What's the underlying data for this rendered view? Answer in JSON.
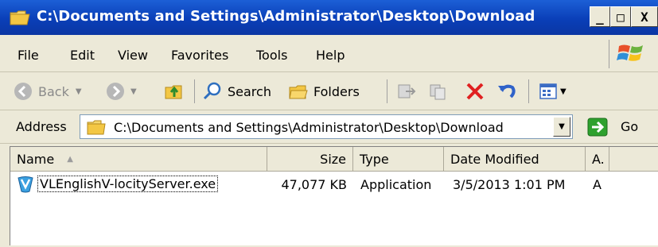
{
  "window": {
    "title": "C:\\Documents and Settings\\Administrator\\Desktop\\Download",
    "minimize_label": "_",
    "maximize_label": "□",
    "close_label": "X"
  },
  "menubar": {
    "items": [
      {
        "label": "File"
      },
      {
        "label": "Edit"
      },
      {
        "label": "View"
      },
      {
        "label": "Favorites"
      },
      {
        "label": "Tools"
      },
      {
        "label": "Help"
      }
    ]
  },
  "toolbar": {
    "back_label": "Back",
    "search_label": "Search",
    "folders_label": "Folders"
  },
  "address": {
    "label": "Address",
    "value": "C:\\Documents and Settings\\Administrator\\Desktop\\Download",
    "go_label": "Go"
  },
  "listview": {
    "columns": [
      "Name",
      "Size",
      "Type",
      "Date Modified",
      "A."
    ],
    "rows": [
      {
        "name": "VLEnglishV-locityServer.exe",
        "size": "47,077 KB",
        "type": "Application",
        "date": "3/5/2013 1:01 PM",
        "attr": "A"
      }
    ]
  },
  "colors": {
    "titlebar": "#0a3fb8",
    "chrome": "#ece9d8",
    "delete_red": "#e02020",
    "go_green": "#2ea12e"
  }
}
